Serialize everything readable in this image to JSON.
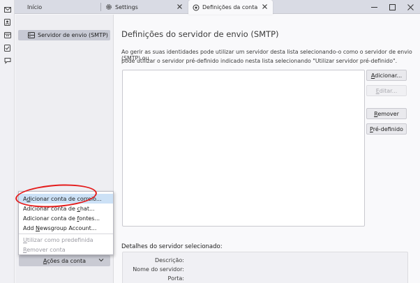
{
  "tabs": [
    {
      "label": "Início",
      "icon": "home-icon"
    },
    {
      "label": "Settings",
      "icon": "gear-icon"
    },
    {
      "label": "Definições da conta",
      "icon": "account-settings-icon"
    }
  ],
  "window_controls": [
    "minimize-icon",
    "maximize-icon",
    "close-icon"
  ],
  "spaces": [
    "mail-icon",
    "address-book-icon",
    "calendar-icon",
    "tasks-icon",
    "chat-icon"
  ],
  "sidebar": {
    "account_item": "Servidor de envio (SMTP)",
    "actions_button": {
      "accel": "A",
      "rest": "ções da conta"
    }
  },
  "menu": {
    "items": [
      {
        "pre": "A",
        "accel": "d",
        "rest": "icionar conta de correio...",
        "enabled": true,
        "highlighted": true
      },
      {
        "pre": "Adicionar conta de ",
        "accel": "c",
        "rest": "hat...",
        "enabled": true
      },
      {
        "pre": "Adicionar conta de ",
        "accel": "f",
        "rest": "ontes...",
        "enabled": true
      },
      {
        "pre": "Add ",
        "accel": "N",
        "rest": "ewsgroup Account...",
        "enabled": true
      },
      {
        "pre": "",
        "accel": "U",
        "rest": "tilizar como predefinida",
        "enabled": false
      },
      {
        "pre": "",
        "accel": "R",
        "rest": "emover conta",
        "enabled": false
      }
    ]
  },
  "main": {
    "title": "Definições do servidor de envio (SMTP)",
    "description_line1": "Ao gerir as suas identidades pode utilizar um servidor desta lista selecionando-o como o servidor de envio (SMTP) ou",
    "description_line2": "pode utilizar o servidor pré-definido indicado nesta lista selecionando \"Utilizar servidor pré-definido\".",
    "buttons": [
      {
        "accel": "A",
        "rest": "dicionar...",
        "enabled": true
      },
      {
        "accel": "E",
        "rest": "ditar...",
        "enabled": false
      },
      {
        "accel": "R",
        "rest": "emover",
        "enabled": true
      },
      {
        "accel": "P",
        "rest": "ré-definido",
        "enabled": true
      }
    ],
    "details_title": "Detalhes do servidor selecionado:",
    "details_labels": [
      "Descrição:",
      "Nome do servidor:",
      "Porta:"
    ]
  }
}
